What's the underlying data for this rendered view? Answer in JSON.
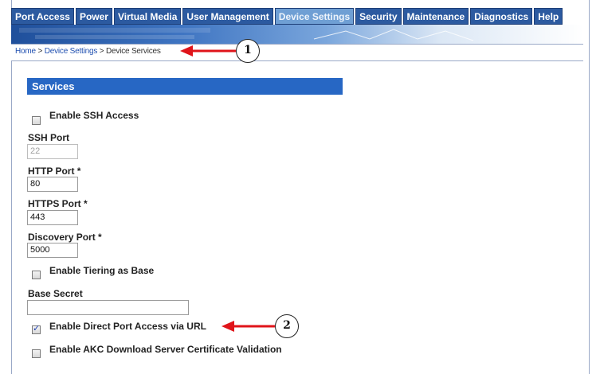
{
  "nav": {
    "tabs": [
      {
        "label": "Port Access"
      },
      {
        "label": "Power"
      },
      {
        "label": "Virtual Media"
      },
      {
        "label": "User Management"
      },
      {
        "label": "Device Settings",
        "active": true
      },
      {
        "label": "Security"
      },
      {
        "label": "Maintenance"
      },
      {
        "label": "Diagnostics"
      },
      {
        "label": "Help"
      }
    ]
  },
  "breadcrumb": {
    "home": "Home",
    "sep": ">",
    "device_settings": "Device Settings",
    "current": "Device Services"
  },
  "callouts": {
    "one": "1",
    "two": "2"
  },
  "services": {
    "title": "Services",
    "enable_ssh": {
      "label": "Enable SSH Access",
      "checked": false
    },
    "ssh_port": {
      "label": "SSH Port",
      "value": "22",
      "disabled": true
    },
    "http_port": {
      "label": "HTTP Port *",
      "value": "80"
    },
    "https_port": {
      "label": "HTTPS Port *",
      "value": "443"
    },
    "discovery_port": {
      "label": "Discovery Port *",
      "value": "5000"
    },
    "enable_tiering": {
      "label": "Enable Tiering as Base",
      "checked": false
    },
    "base_secret": {
      "label": "Base Secret",
      "value": ""
    },
    "enable_direct_port": {
      "label": "Enable Direct Port Access via URL",
      "checked": true
    },
    "enable_akc": {
      "label": "Enable AKC Download Server Certificate Validation",
      "checked": false
    }
  },
  "colors": {
    "nav_tab": "#2c5aa0",
    "nav_tab_active": "#6f9fd4",
    "section_header": "#2767c4",
    "arrow": "#e0141a"
  }
}
